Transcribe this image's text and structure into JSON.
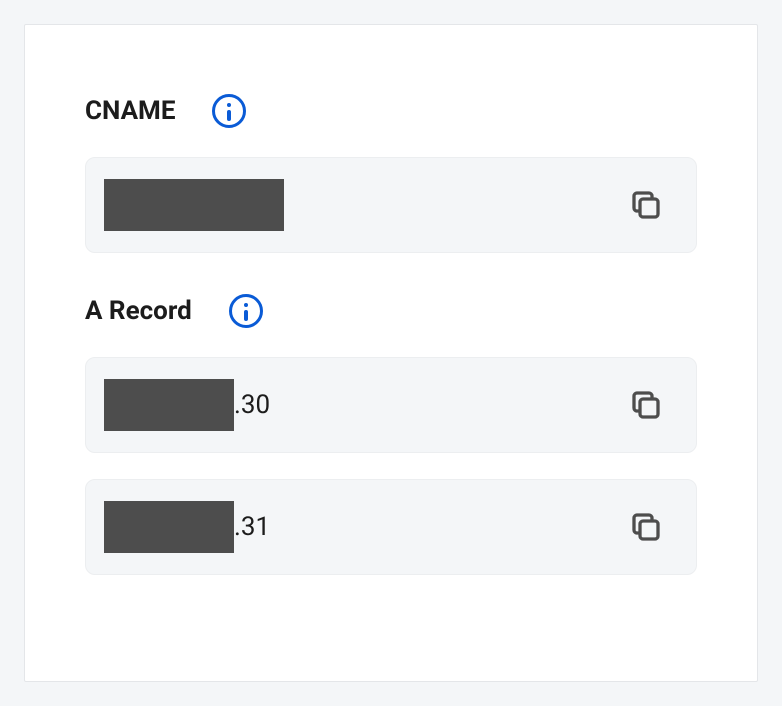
{
  "sections": {
    "cname": {
      "title": "CNAME",
      "records": [
        {
          "suffix": ""
        }
      ]
    },
    "arecord": {
      "title": "A Record",
      "records": [
        {
          "suffix": ".30"
        },
        {
          "suffix": ".31"
        }
      ]
    }
  }
}
